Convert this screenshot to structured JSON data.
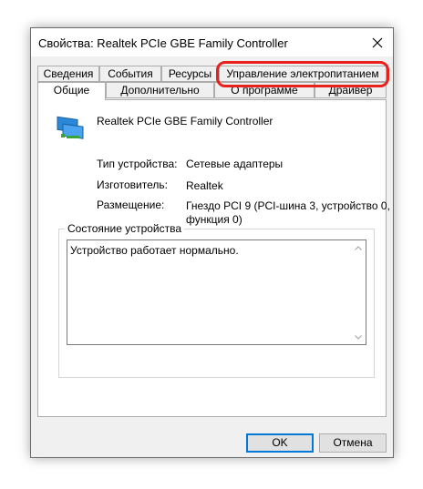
{
  "window": {
    "title": "Свойства: Realtek PCIe GBE Family Controller"
  },
  "tabs_row1": [
    {
      "label": "Сведения"
    },
    {
      "label": "События"
    },
    {
      "label": "Ресурсы"
    },
    {
      "label": "Управление электропитанием"
    }
  ],
  "tabs_row2": [
    {
      "label": "Общие"
    },
    {
      "label": "Дополнительно"
    },
    {
      "label": "О программе"
    },
    {
      "label": "Драйвер"
    }
  ],
  "active_tab": "Общие",
  "highlighted_tab": "Управление электропитанием",
  "highlight_color": "#e8211d",
  "device": {
    "name": "Realtek PCIe GBE Family Controller",
    "icon": "network-adapter-icon",
    "properties": [
      {
        "label": "Тип устройства:",
        "value": "Сетевые адаптеры"
      },
      {
        "label": "Изготовитель:",
        "value": "Realtek"
      },
      {
        "label": "Размещение:",
        "value_line1": "Гнездо PCI 9 (PCI-шина 3, устройство 0,",
        "value_line2": "функция 0)"
      }
    ]
  },
  "status_group": {
    "legend": "Состояние устройства",
    "text": "Устройство работает нормально."
  },
  "buttons": {
    "ok": "OK",
    "cancel": "Отмена"
  },
  "colors": {
    "accent": "#0078d7",
    "dialog_bg": "#f0f0f0"
  }
}
